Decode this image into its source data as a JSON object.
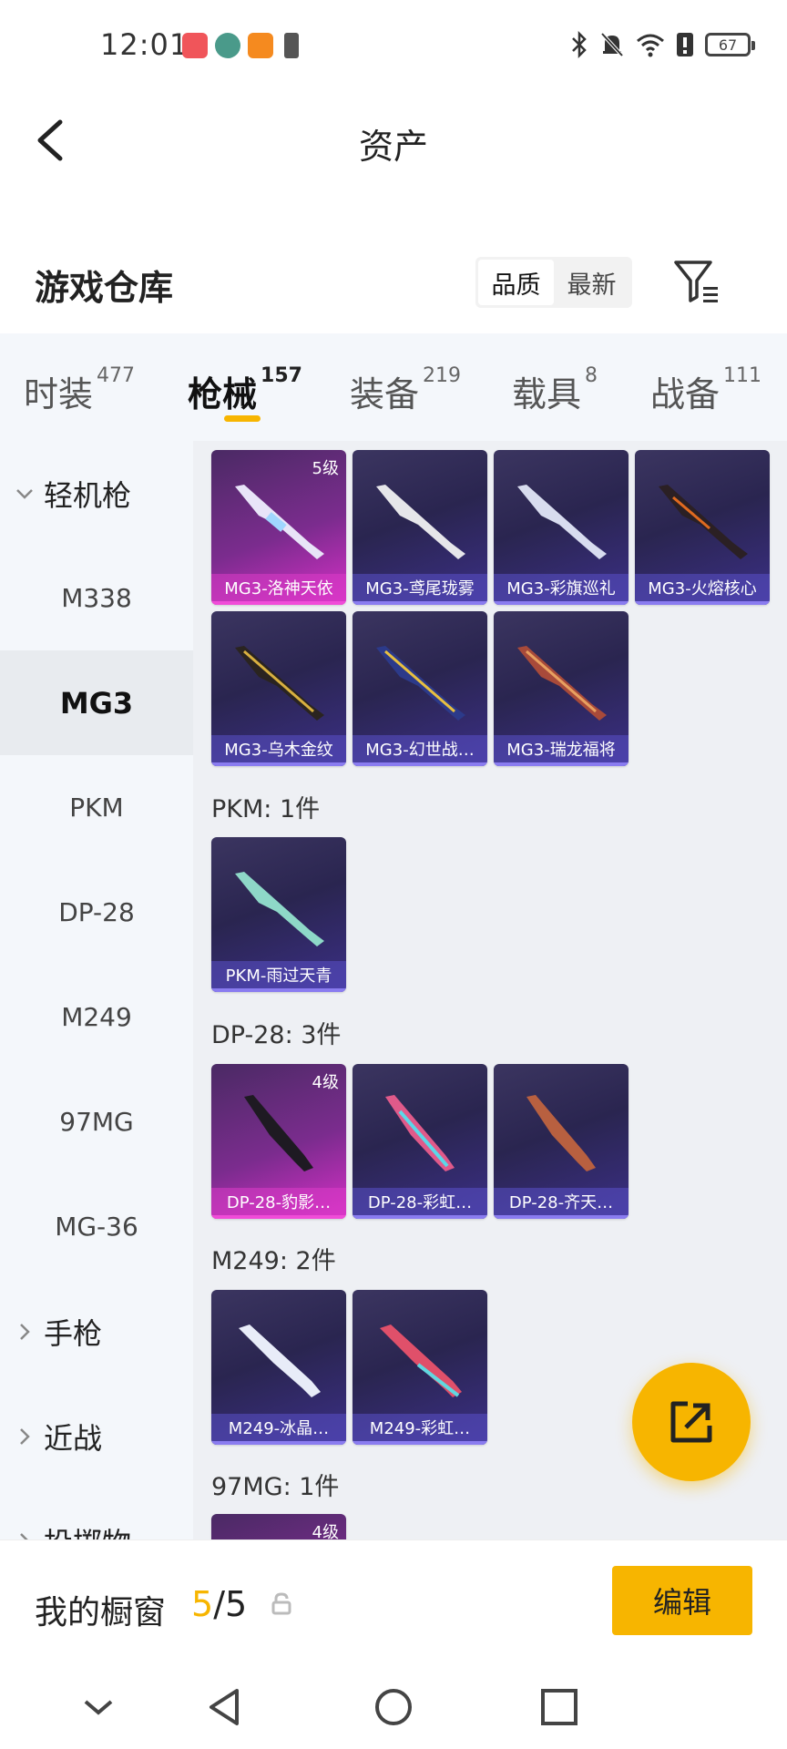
{
  "status": {
    "time": "12:01",
    "battery": "67"
  },
  "header": {
    "title": "资产"
  },
  "warehouse": {
    "title": "游戏仓库",
    "sort_options": [
      "品质",
      "最新"
    ],
    "active_sort": "品质"
  },
  "tabs": [
    {
      "label": "时装",
      "count": "477"
    },
    {
      "label": "枪械",
      "count": "157"
    },
    {
      "label": "装备",
      "count": "219"
    },
    {
      "label": "载具",
      "count": "8"
    },
    {
      "label": "战备",
      "count": "111"
    }
  ],
  "sidebar": {
    "group_lmg": "轻机枪",
    "items": [
      "M338",
      "MG3",
      "PKM",
      "DP-28",
      "M249",
      "97MG",
      "MG-36"
    ],
    "active_item": "MG3",
    "group_pistol": "手枪",
    "group_melee": "近战",
    "group_throw": "投掷物"
  },
  "sections": [
    {
      "label": "",
      "cards": [
        {
          "name": "MG3-洛神天依",
          "level": "5级",
          "rarity": "legend"
        },
        {
          "name": "MG3-鸢尾珑雾",
          "level": "",
          "rarity": "epic"
        },
        {
          "name": "MG3-彩旗巡礼",
          "level": "",
          "rarity": "epic"
        },
        {
          "name": "MG3-火熔核心",
          "level": "",
          "rarity": "epic"
        },
        {
          "name": "MG3-乌木金纹",
          "level": "",
          "rarity": "epic"
        },
        {
          "name": "MG3-幻世战…",
          "level": "",
          "rarity": "epic"
        },
        {
          "name": "MG3-瑞龙福将",
          "level": "",
          "rarity": "epic"
        }
      ]
    },
    {
      "label": "PKM: 1件",
      "cards": [
        {
          "name": "PKM-雨过天青",
          "level": "",
          "rarity": "epic"
        }
      ]
    },
    {
      "label": "DP-28: 3件",
      "cards": [
        {
          "name": "DP-28-豹影…",
          "level": "4级",
          "rarity": "legend"
        },
        {
          "name": "DP-28-彩虹…",
          "level": "",
          "rarity": "epic"
        },
        {
          "name": "DP-28-齐天…",
          "level": "",
          "rarity": "epic"
        }
      ]
    },
    {
      "label": "M249: 2件",
      "cards": [
        {
          "name": "M249-冰晶…",
          "level": "",
          "rarity": "epic"
        },
        {
          "name": "M249-彩虹…",
          "level": "",
          "rarity": "epic"
        }
      ]
    },
    {
      "label": "97MG: 1件",
      "cards": [
        {
          "name": "",
          "level": "4级",
          "rarity": "legend"
        }
      ]
    }
  ],
  "showcase": {
    "label": "我的橱窗",
    "current": "5",
    "total": "/5",
    "edit_label": "编辑"
  },
  "colors": {
    "accent": "#f7b500",
    "legend": "#d72fc7",
    "epic": "#3b2f86"
  }
}
